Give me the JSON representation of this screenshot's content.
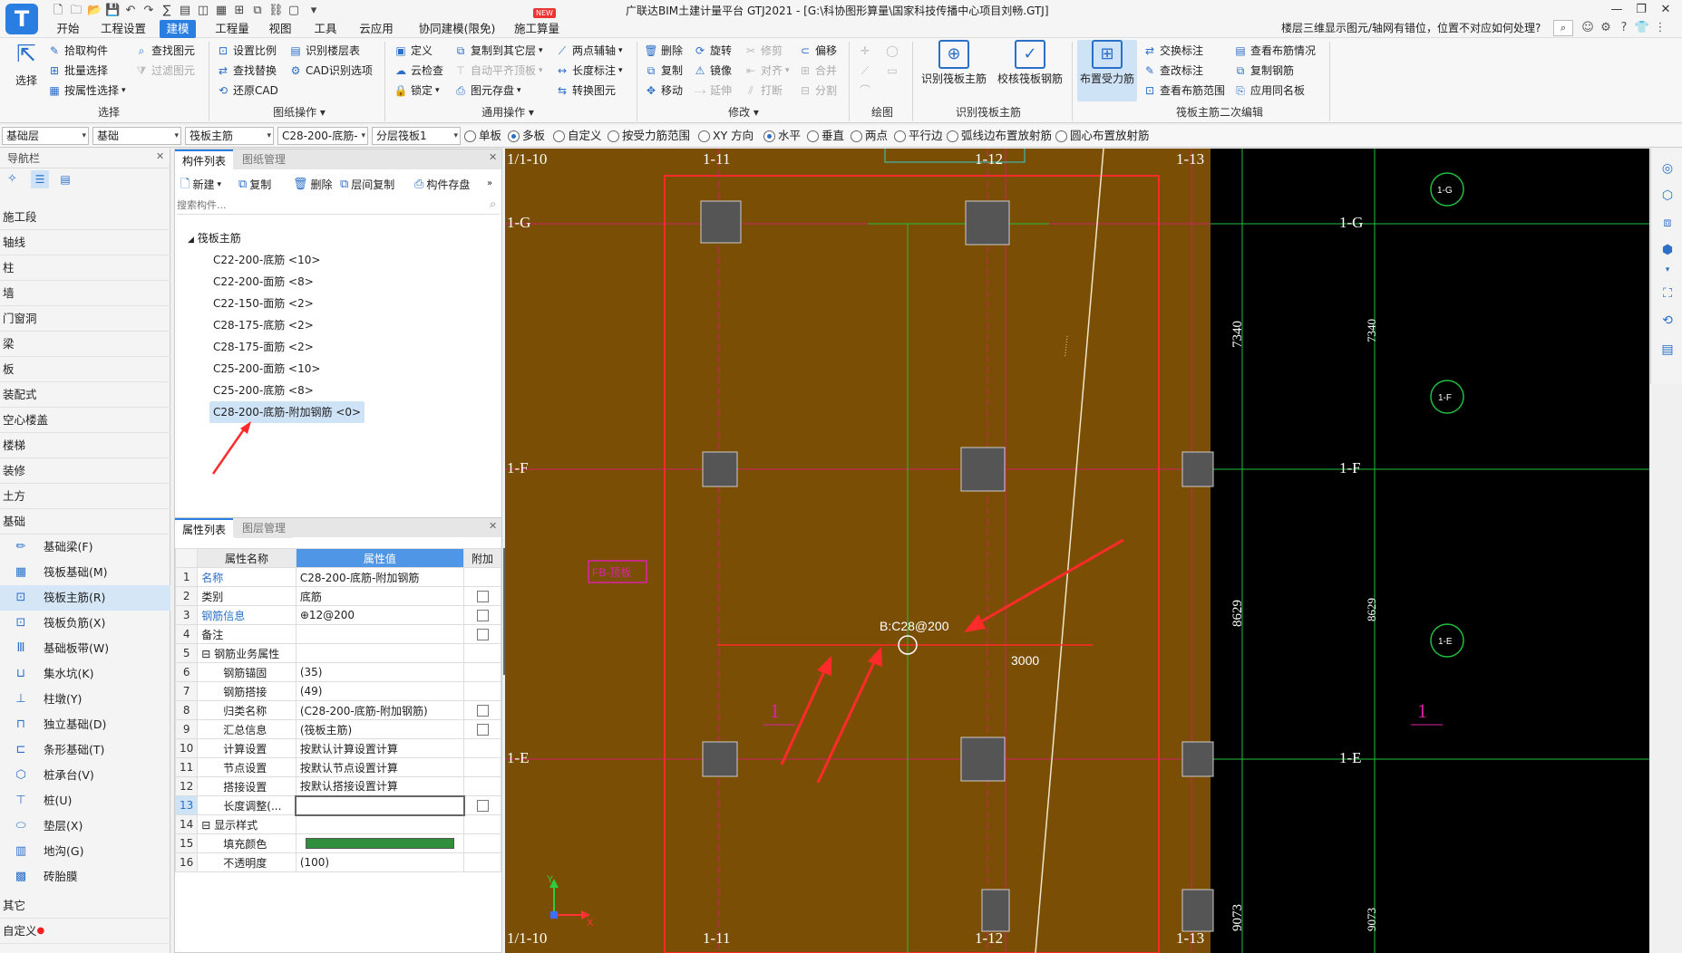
{
  "app": {
    "title": "广联达BIM土建计量平台 GTJ2021 - [G:\\科协图形算量\\国家科技传播中心项目刘畅.GTJ]",
    "new_badge": "NEW",
    "help_question": "楼层三维显示图元/轴网有错位，位置不对应如何处理?"
  },
  "menu": [
    "开始",
    "工程设置",
    "建模",
    "工程量",
    "视图",
    "工具",
    "云应用",
    "协同建模(限免)",
    "施工算量"
  ],
  "ribbon": {
    "select": {
      "big": "选择",
      "items": [
        "拾取构件",
        "批量选择",
        "按属性选择",
        "查找图元",
        "过滤图元"
      ],
      "label": "选择"
    },
    "drawing": {
      "items": [
        "设置比例",
        "查找替换",
        "还原CAD",
        "识别楼层表",
        "CAD识别选项"
      ],
      "label": "图纸操作"
    },
    "common": {
      "items": [
        "定义",
        "云检查",
        "锁定",
        "复制到其它层",
        "自动平齐顶板",
        "图元存盘",
        "两点辅轴",
        "长度标注",
        "转换图元"
      ],
      "label": "通用操作"
    },
    "modify": {
      "items": [
        "删除",
        "复制",
        "移动",
        "旋转",
        "镜像",
        "延伸",
        "修剪",
        "对齐",
        "打断",
        "偏移",
        "合并",
        "分割"
      ],
      "label": "修改"
    },
    "draw": {
      "label": "绘图"
    },
    "recognize": {
      "items": [
        "识别筏板主筋",
        "校核筏板钢筋"
      ],
      "label": "识别筏板主筋"
    },
    "edit2": {
      "active": "布置受力筋",
      "items": [
        "交换标注",
        "查改标注",
        "查看布筋范围",
        "查看布筋情况",
        "复制钢筋",
        "应用同名板"
      ],
      "label": "筏板主筋二次编辑"
    }
  },
  "propbar": {
    "dropdowns": [
      "基础层",
      "基础",
      "筏板主筋",
      "C28-200-底筋-",
      "分层筏板1"
    ],
    "radios": [
      {
        "label": "单板",
        "on": false
      },
      {
        "label": "多板",
        "on": true
      },
      {
        "label": "自定义",
        "on": false
      },
      {
        "label": "按受力筋范围",
        "on": false
      },
      {
        "label": "XY 方向",
        "on": false
      },
      {
        "label": "水平",
        "on": true
      },
      {
        "label": "垂直",
        "on": false
      },
      {
        "label": "两点",
        "on": false
      },
      {
        "label": "平行边",
        "on": false
      },
      {
        "label": "弧线边布置放射筋",
        "on": false
      },
      {
        "label": "圆心布置放射筋",
        "on": false
      }
    ]
  },
  "nav": {
    "title": "导航栏",
    "categories": [
      "施工段",
      "轴线",
      "柱",
      "墙",
      "门窗洞",
      "梁",
      "板",
      "装配式",
      "空心楼盖",
      "楼梯",
      "装修",
      "土方",
      "基础"
    ],
    "sub_items": [
      "基础梁(F)",
      "筏板基础(M)",
      "筏板主筋(R)",
      "筏板负筋(X)",
      "基础板带(W)",
      "集水坑(K)",
      "柱墩(Y)",
      "独立基础(D)",
      "条形基础(T)",
      "桩承台(V)",
      "桩(U)",
      "垫层(X)",
      "地沟(G)",
      "砖胎膜"
    ],
    "bottom": [
      "其它",
      "自定义"
    ]
  },
  "component_list": {
    "tabs": [
      "构件列表",
      "图纸管理"
    ],
    "toolbar": [
      "新建",
      "复制",
      "删除",
      "层间复制",
      "构件存盘"
    ],
    "search_placeholder": "搜索构件...",
    "root": "筏板主筋",
    "items": [
      "C22-200-底筋 <10>",
      "C22-200-面筋 <8>",
      "C22-150-面筋 <2>",
      "C28-175-底筋 <2>",
      "C28-175-面筋 <2>",
      "C25-200-面筋 <10>",
      "C25-200-底筋 <8>",
      "C28-200-底筋-附加钢筋 <0>"
    ]
  },
  "properties": {
    "tabs": [
      "属性列表",
      "图层管理"
    ],
    "headers": [
      "属性名称",
      "属性值",
      "附加"
    ],
    "rows": [
      {
        "n": "1",
        "name": "名称",
        "value": "C28-200-底筋-附加钢筋",
        "cb": false
      },
      {
        "n": "2",
        "name": "类别",
        "value": "底筋",
        "cb": true
      },
      {
        "n": "3",
        "name": "钢筋信息",
        "value": "⊕12@200",
        "cb": true
      },
      {
        "n": "4",
        "name": "备注",
        "value": "",
        "cb": true
      },
      {
        "n": "5",
        "name": "⊟ 钢筋业务属性",
        "value": "",
        "cb": false
      },
      {
        "n": "6",
        "name": "钢筋锚固",
        "value": "(35)",
        "cb": false
      },
      {
        "n": "7",
        "name": "钢筋搭接",
        "value": "(49)",
        "cb": false
      },
      {
        "n": "8",
        "name": "归类名称",
        "value": "(C28-200-底筋-附加钢筋)",
        "cb": true
      },
      {
        "n": "9",
        "name": "汇总信息",
        "value": "(筏板主筋)",
        "cb": true
      },
      {
        "n": "10",
        "name": "计算设置",
        "value": "按默认计算设置计算",
        "cb": false
      },
      {
        "n": "11",
        "name": "节点设置",
        "value": "按默认节点设置计算",
        "cb": false
      },
      {
        "n": "12",
        "name": "搭接设置",
        "value": "按默认搭接设置计算",
        "cb": false
      },
      {
        "n": "13",
        "name": "长度调整(...",
        "value": "",
        "cb": true
      },
      {
        "n": "14",
        "name": "⊟ 显示样式",
        "value": "",
        "cb": false
      },
      {
        "n": "15",
        "name": "填充颜色",
        "value": "",
        "cb": false
      },
      {
        "n": "16",
        "name": "不透明度",
        "value": "(100)",
        "cb": false
      }
    ],
    "fill_color": "#2f8f3a"
  },
  "cad": {
    "axis_top": [
      "1/1-10",
      "1-11",
      "1-12",
      "1-13"
    ],
    "axis_bottom": [
      "1/1-10",
      "1-11",
      "1-12",
      "1-13"
    ],
    "axis_left": [
      "1-G",
      "1-F",
      "1-E"
    ],
    "axis_right": [
      "1-G",
      "1-F",
      "1-E"
    ],
    "dims": [
      "7340",
      "7340",
      "8629",
      "8629",
      "9073",
      "9073"
    ],
    "rebar_label": "B:C28@200",
    "length_label": "3000",
    "tag": "FB-顶板",
    "marks": [
      "1",
      "1"
    ],
    "slab_color": "#7a4f05",
    "accent_red": "#ff2a2a"
  }
}
